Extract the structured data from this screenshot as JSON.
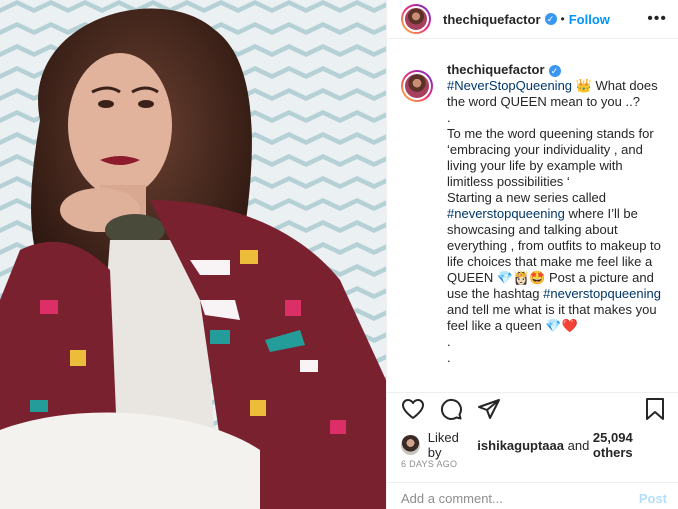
{
  "post": {
    "username": "thechiquefactor",
    "dot": "•",
    "follow_label": "Follow",
    "more_label": "•••"
  },
  "caption": {
    "username": "thechiquefactor",
    "hashtag_1": "#NeverStopQueening",
    "emoji_crown": "👑",
    "line_1": " What does the word QUEEN mean to you ..?",
    "line_2": ".",
    "line_3": "To me the word queening stands for ‘embracing your individuality , and living your life by example with limitless possibilities ‘",
    "line_4_a": "Starting a new series called ",
    "hashtag_2": "#neverstopqueening",
    "line_4_b": " where I’ll be showcasing and talking about everything , from outfits to makeup to life choices that make me feel like a QUEEN 💎👸🏻🤩 Post a picture and use the hashtag ",
    "hashtag_3": "#neverstopqueening",
    "line_4_c": " and tell me what is it that makes you feel like a queen 💎❤️",
    "line_5": ".",
    "line_6": "."
  },
  "actions": {
    "like_icon": "heart-icon",
    "comment_icon": "comment-icon",
    "share_icon": "share-icon",
    "save_icon": "bookmark-icon"
  },
  "likes": {
    "prefix": "Liked by ",
    "user": "ishikaguptaaa",
    "middle": " and ",
    "count": "25,094 others"
  },
  "timestamp": "6 DAYS AGO",
  "comment": {
    "placeholder": "Add a comment...",
    "post_label": "Post"
  },
  "colors": {
    "accent": "#0095f6",
    "post_disabled": "#b2dffc",
    "hashtag": "#00376b"
  }
}
